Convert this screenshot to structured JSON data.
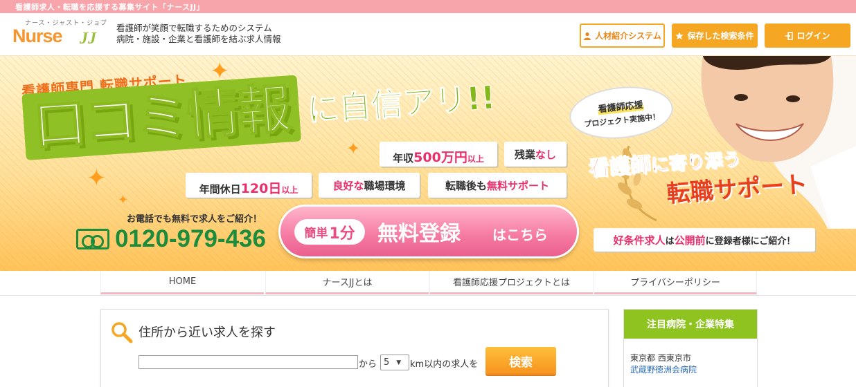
{
  "top_strip": {
    "text": "看護師求人・転職を応援する募集サイト「ナースJJ」"
  },
  "header": {
    "logo_kana": "ナース・ジャスト・ジョブ",
    "logo_nurse": "Nurse",
    "logo_jj": "JJ",
    "tagline_1": "看護師が笑顔で転職するためのシステム",
    "tagline_2": "病院・施設・企業と看護師を結ぶ求人情報",
    "btn_agency": "人材紹介システム",
    "btn_saved": "保存した検索条件",
    "btn_login": "ログイン"
  },
  "hero": {
    "subtitle": "看護師専門 転職サポート",
    "headline_big": "口コミ情報",
    "headline_rest": "に自信アリ!!",
    "tag_income_pre": "年収",
    "tag_income_num": "500万円",
    "tag_income_post": "以上",
    "tag_overtime_pre": "残業",
    "tag_overtime_hl": "なし",
    "tag_holiday_pre": "年間休日",
    "tag_holiday_num": "120日",
    "tag_holiday_post": "以上",
    "tag_env_hl": "良好な",
    "tag_env_post": "職場環境",
    "tag_after_pre": "転職後も",
    "tag_after_hl": "無料サポート",
    "phone_label": "お電話でも無料で求人をご紹介！",
    "phone_number": "0120-979-436",
    "cta_pill_pre": "簡単",
    "cta_pill_num": "1分",
    "cta_main": "無料登録",
    "cta_after": "はこちら",
    "bubble_1": "看護師応援",
    "bubble_2": "プロジェクト実施中！",
    "support_1a": "看護師",
    "support_1b": "に寄り添う",
    "support_2": "転職サポート",
    "note_hl1": "好条件求人",
    "note_mid": "は",
    "note_hl2": "公開前",
    "note_post": "に登録者様にご紹介！"
  },
  "nav": {
    "items": [
      {
        "label": "HOME"
      },
      {
        "label": "ナースJJとは"
      },
      {
        "label": "看護師応援プロジェクトとは"
      },
      {
        "label": "プライバシーポリシー"
      }
    ]
  },
  "search": {
    "title": "住所から近い求人を探す",
    "address_value": "",
    "label_from": "から",
    "km_value": "5",
    "label_km": "km以内の求人を",
    "button": "検索"
  },
  "sidebar": {
    "heading": "注目病院・企業特集",
    "location": "東京都 西東京市",
    "hospital": "武蔵野徳洲会病院"
  },
  "colors": {
    "accent_orange": "#f5a623",
    "top_strip_pink": "#f7a4ab",
    "brand_green": "#8fc31f",
    "cta_pink": "#f67da4",
    "phone_green": "#1b8c3c",
    "highlight_pink": "#ea2f6b"
  },
  "icons": [
    "user-icon",
    "star-icon",
    "login-icon",
    "free-dial-icon",
    "magnifier-icon",
    "sparkle-icon"
  ]
}
